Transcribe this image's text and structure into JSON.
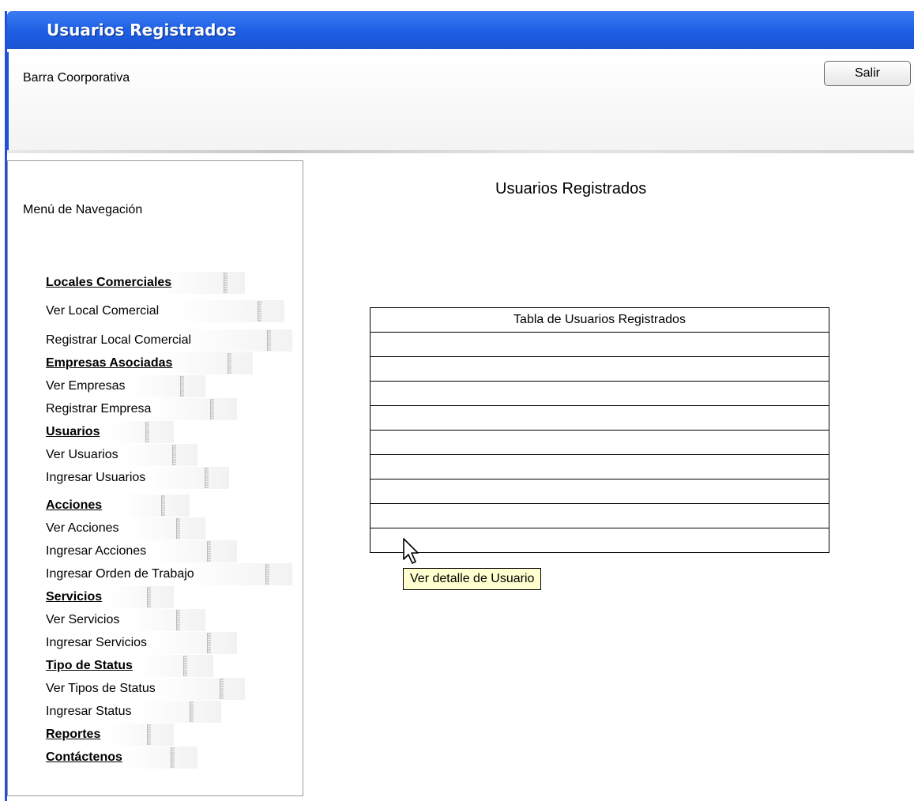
{
  "window": {
    "title": "Usuarios Registrados"
  },
  "header": {
    "corporate_bar_label": "Barra Coorporativa",
    "logout_label": "Salir"
  },
  "sidebar": {
    "title": "Menú de Navegación",
    "items": [
      {
        "label": "Locales Comerciales",
        "section": true
      },
      {
        "label": "Ver Local Comercial",
        "section": false
      },
      {
        "label": "Registrar Local Comercial",
        "section": false
      },
      {
        "label": "Empresas Asociadas",
        "section": true
      },
      {
        "label": "Ver Empresas",
        "section": false
      },
      {
        "label": "Registrar Empresa",
        "section": false
      },
      {
        "label": "Usuarios",
        "section": true
      },
      {
        "label": "Ver Usuarios",
        "section": false
      },
      {
        "label": "Ingresar Usuarios",
        "section": false
      },
      {
        "label": "Acciones",
        "section": true
      },
      {
        "label": "Ver Acciones",
        "section": false
      },
      {
        "label": "Ingresar Acciones",
        "section": false
      },
      {
        "label": "Ingresar Orden de Trabajo",
        "section": false
      },
      {
        "label": "Servicios",
        "section": true
      },
      {
        "label": "Ver Servicios",
        "section": false
      },
      {
        "label": "Ingresar Servicios",
        "section": false
      },
      {
        "label": "Tipo de Status",
        "section": true
      },
      {
        "label": "Ver Tipos de Status",
        "section": false
      },
      {
        "label": "Ingresar Status",
        "section": false
      },
      {
        "label": "Reportes",
        "section": true
      },
      {
        "label": "Contáctenos",
        "section": true
      }
    ]
  },
  "main": {
    "title": "Usuarios Registrados",
    "table_header": "Tabla de Usuarios Registrados",
    "empty_rows": 9,
    "tooltip": "Ver detalle de Usuario"
  },
  "colors": {
    "titlebar": "#1d5ee3",
    "frame": "#1f52d8",
    "tooltip_bg": "#ffffd0"
  },
  "icons": {
    "cursor": "pointer-arrow-icon"
  }
}
